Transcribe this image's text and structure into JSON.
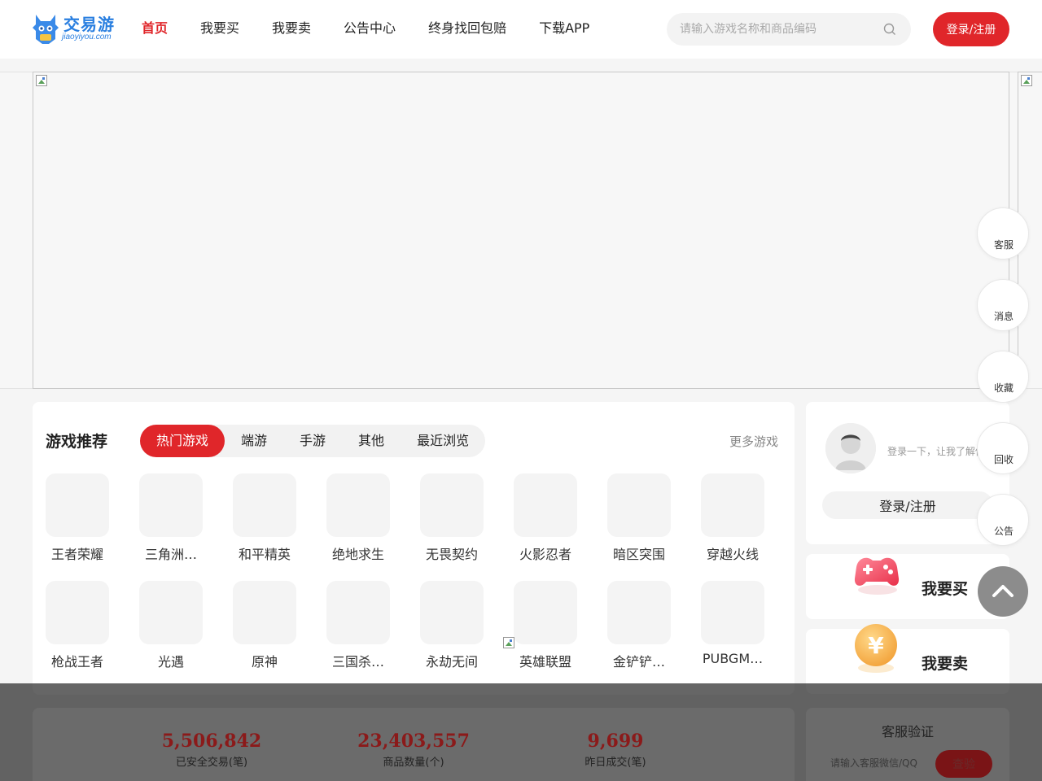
{
  "header": {
    "logo_text": "交易游",
    "logo_sub": "jiaoyiyou.com",
    "nav": [
      {
        "label": "首页",
        "active": true
      },
      {
        "label": "我要买"
      },
      {
        "label": "我要卖"
      },
      {
        "label": "公告中心"
      },
      {
        "label": "终身找回包赔"
      },
      {
        "label": "下载APP"
      }
    ],
    "search_placeholder": "请输入游戏名称和商品编码",
    "login_label": "登录/注册"
  },
  "games": {
    "title": "游戏推荐",
    "tabs": [
      "热门游戏",
      "端游",
      "手游",
      "其他",
      "最近浏览"
    ],
    "active_tab": 0,
    "more_label": "更多游戏",
    "items": [
      "王者荣耀",
      "三角洲…",
      "和平精英",
      "绝地求生",
      "无畏契约",
      "火影忍者",
      "暗区突围",
      "穿越火线",
      "枪战王者",
      "光遇",
      "原神",
      "三国杀…",
      "永劫无间",
      "英雄联盟",
      "金铲铲…",
      "PUBGM…"
    ]
  },
  "user_panel": {
    "tip": "登录一下，让我了解你",
    "login_label": "登录/注册"
  },
  "actions": {
    "buy_label": "我要买",
    "sell_label": "我要卖"
  },
  "float_bar": [
    "客服",
    "消息",
    "收藏",
    "回收",
    "公告"
  ],
  "stats": [
    {
      "value": "5,506,842",
      "label": "已安全交易(笔)"
    },
    {
      "value": "23,403,557",
      "label": "商品数量(个)"
    },
    {
      "value": "9,699",
      "label": "昨日成交(笔)"
    }
  ],
  "verify": {
    "title": "客服验证",
    "placeholder": "请输入客服微信/QQ",
    "button_label": "查验"
  },
  "colors": {
    "accent": "#e0262a",
    "brand_blue": "#2a7fe0",
    "stat_value": "#8b1a1a"
  }
}
